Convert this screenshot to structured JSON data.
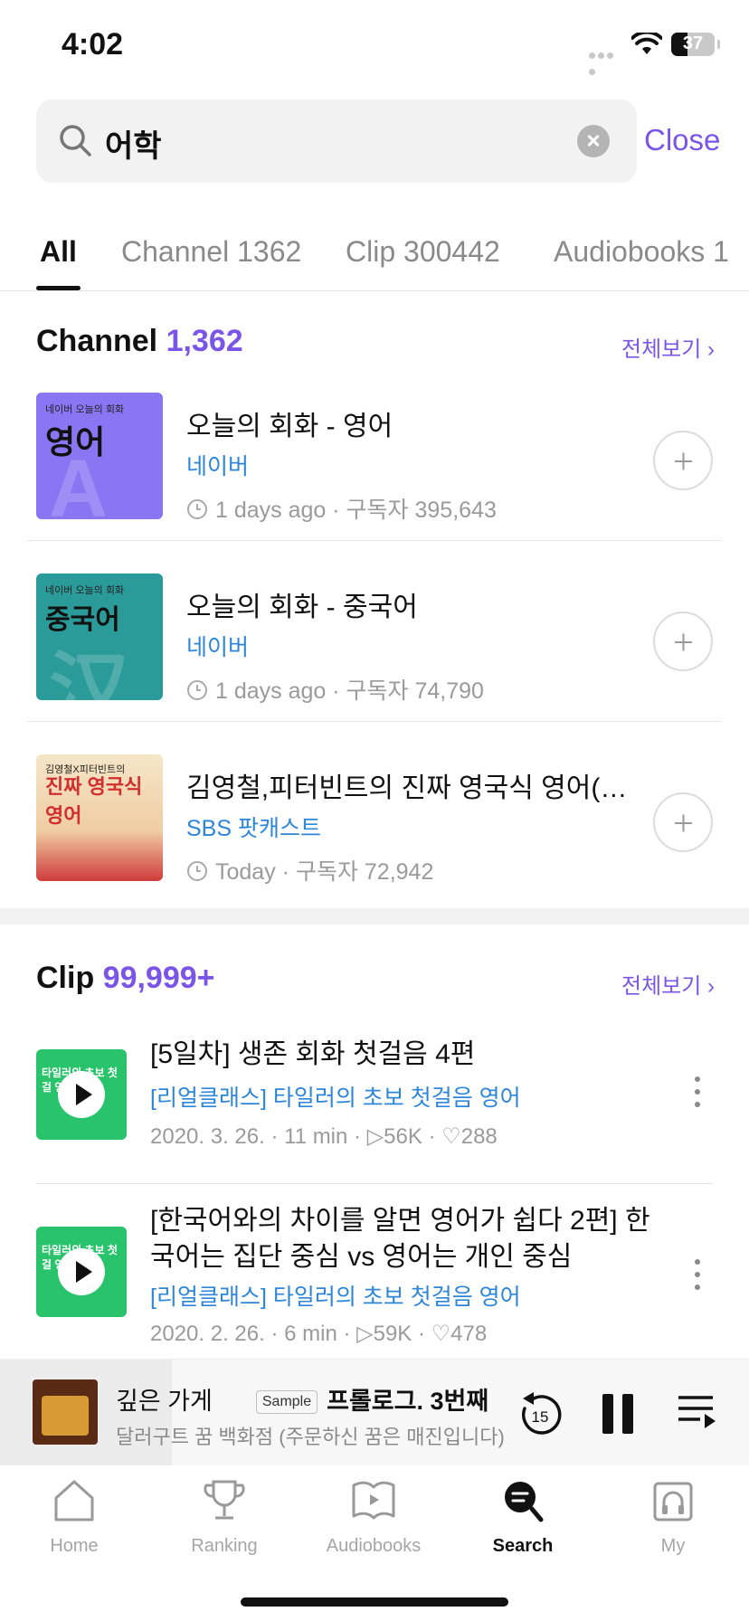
{
  "status_bar": {
    "time": "4:02",
    "battery": "37"
  },
  "search": {
    "query": "어학",
    "close_label": "Close"
  },
  "tabs": [
    {
      "label": "All"
    },
    {
      "label": "Channel 1362"
    },
    {
      "label": "Clip 300442"
    },
    {
      "label": "Audiobooks 1"
    }
  ],
  "channel_section": {
    "title": "Channel",
    "count": "1,362",
    "see_all": "전체보기 ›",
    "items": [
      {
        "name": "오늘의 회화 - 영어",
        "owner": "네이버",
        "updated": "1 days ago",
        "subscribers": "구독자 395,643",
        "thumb_small": "네이버 오늘의 회화",
        "thumb_big": "영어",
        "thumb_letter": "A"
      },
      {
        "name": "오늘의 회화 - 중국어",
        "owner": "네이버",
        "updated": "1 days ago",
        "subscribers": "구독자 74,790",
        "thumb_small": "네이버 오늘의 회화",
        "thumb_big": "중국어",
        "thumb_letter": "汉"
      },
      {
        "name": "김영철,피터빈트의 진짜 영국식 영어(…",
        "owner": "SBS 팟캐스트",
        "updated": "Today",
        "subscribers": "구독자 72,942",
        "thumb_small": "김영철X피터빈트의",
        "thumb_big": "진짜 영국식 영어",
        "thumb_letter": ""
      }
    ]
  },
  "clip_section": {
    "title": "Clip",
    "count": "99,999+",
    "see_all": "전체보기 ›",
    "items": [
      {
        "title": "[5일차] 생존 회화 첫걸음 4편",
        "channel": "[리얼클래스] 타일러의 초보 첫걸음 영어",
        "date": "2020. 3. 26.",
        "duration": "11 min",
        "plays": "56K",
        "likes": "288",
        "thumb_tag": "타일러의 초보 첫걸 영어"
      },
      {
        "title": "[한국어와의 차이를 알면 영어가 쉽다 2편] 한국어는 집단 중심 vs 영어는 개인 중심",
        "channel": "[리얼클래스] 타일러의 초보 첫걸음 영어",
        "date": "2020. 2. 26.",
        "duration": "6 min",
        "plays": "59K",
        "likes": "478",
        "thumb_tag": "타일러의 초보 첫걸 영어"
      }
    ]
  },
  "player": {
    "title": "깊은 가게",
    "sample_label": "Sample",
    "episode": "프롤로그. 3번째",
    "subtitle": "달러구트 꿈 백화점 (주문하신 꿈은 매진입니다)",
    "rewind_label": "15"
  },
  "tabbar": [
    {
      "label": "Home",
      "icon": "home-icon"
    },
    {
      "label": "Ranking",
      "icon": "trophy-icon"
    },
    {
      "label": "Audiobooks",
      "icon": "book-icon"
    },
    {
      "label": "Search",
      "icon": "search-icon"
    },
    {
      "label": "My",
      "icon": "headphones-icon"
    }
  ],
  "colors": {
    "accent": "#7a55e8",
    "link": "#2d86d9",
    "clip_thumb": "#28c36a"
  }
}
